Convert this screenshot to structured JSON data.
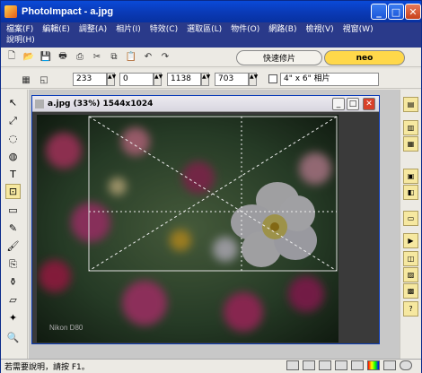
{
  "app": {
    "title": "PhotoImpact - a.jpg"
  },
  "menu": [
    "檔案(F)",
    "編輯(E)",
    "調整(A)",
    "相片(I)",
    "特效(C)",
    "選取區(L)",
    "物件(O)",
    "網路(B)",
    "檢視(V)",
    "視窗(W)",
    "說明(H)"
  ],
  "toolbar": {
    "quick_fix": "快速修片",
    "neo": "neo"
  },
  "attr": {
    "x": "233",
    "y": "0",
    "w": "1138",
    "h": "703",
    "preset": "4\" x 6\" 相片"
  },
  "doc": {
    "title": "a.jpg (33%) 1544x1024",
    "watermark": "Nikon D80"
  },
  "status": {
    "text": "若需要說明，請按 F1。"
  },
  "icons": [
    "photoimpact-app-icon",
    "new-icon",
    "open-icon",
    "save-icon",
    "print-icon",
    "scan-icon",
    "cut-icon",
    "copy-icon",
    "paste-icon",
    "undo-icon",
    "redo-icon"
  ]
}
